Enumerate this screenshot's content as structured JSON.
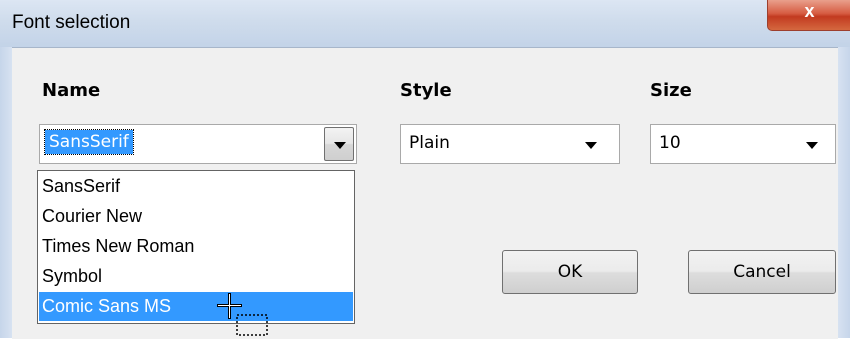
{
  "window": {
    "title": "Font selection",
    "close_glyph": "x"
  },
  "labels": {
    "name": "Name",
    "style": "Style",
    "size": "Size"
  },
  "name_combo": {
    "value": "SansSerif",
    "options": [
      "SansSerif",
      "Courier New",
      "Times New Roman",
      "Symbol",
      "Comic Sans MS"
    ],
    "highlighted_option": "Comic Sans MS"
  },
  "style_combo": {
    "value": "Plain"
  },
  "size_combo": {
    "value": "10"
  },
  "buttons": {
    "ok": "OK",
    "cancel": "Cancel"
  },
  "icons": {
    "dropdown_arrow": "chevron-down-icon",
    "cursor": "move-cursor-icon"
  },
  "colors": {
    "selection": "#3399ff",
    "close_button": "#c9462c",
    "titlebar": "#cfdcec"
  }
}
